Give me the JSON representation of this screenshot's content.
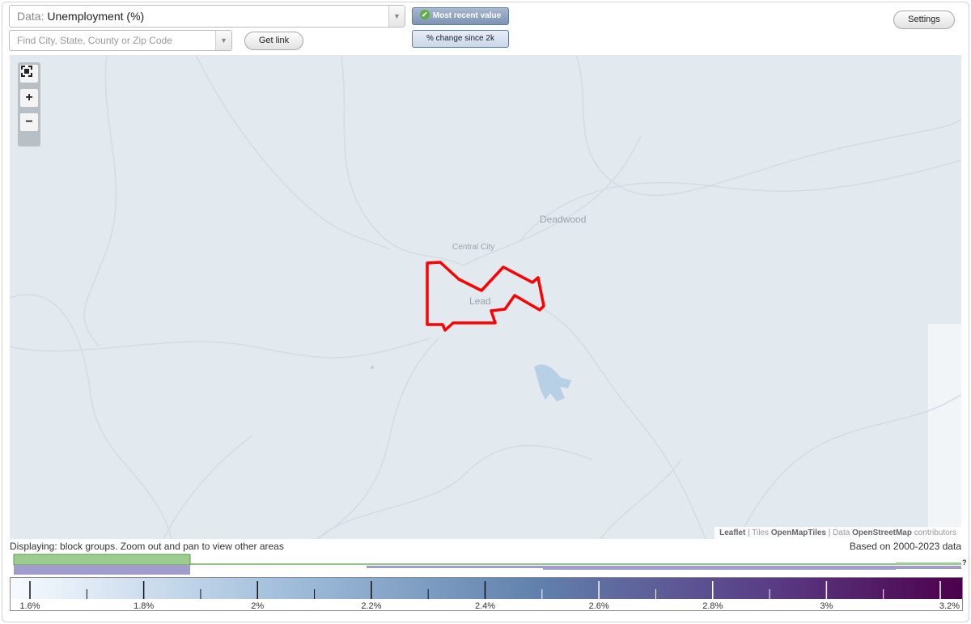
{
  "controls": {
    "data_label": "Data:",
    "data_value": "Unemployment (%)",
    "search_placeholder": "Find City, State, County or Zip Code",
    "get_link": "Get link",
    "toggle_recent": "Most recent value",
    "toggle_change": "% change since 2k",
    "settings": "Settings"
  },
  "map": {
    "places": [
      {
        "name": "Deadwood",
        "size": "large"
      },
      {
        "name": "Central City",
        "size": "small"
      },
      {
        "name": "Lead",
        "size": "medium"
      }
    ],
    "zoom_in": "+",
    "zoom_out": "−",
    "highlight_color": "#ff0000",
    "attribution": {
      "leaflet": "Leaflet",
      "sep1": " | Tiles ",
      "tiles": "OpenMapTiles",
      "sep2": " | Data ",
      "osm": "OpenStreetMap",
      "contrib": " contributors"
    }
  },
  "status": {
    "displaying": "Displaying: block groups. Zoom out and pan to view other areas",
    "based_on": "Based on 2000-2023 data"
  },
  "histogram_help": "?",
  "legend": {
    "tick_labels": [
      "1.6%",
      "1.8%",
      "2%",
      "2.2%",
      "2.4%",
      "2.6%",
      "2.8%",
      "3%",
      "3.2%"
    ],
    "min": 1.6,
    "max": 3.2,
    "colors": [
      "#f7fbff",
      "#9ebcda",
      "#6182ad",
      "#5a3c85",
      "#4d004b"
    ]
  }
}
